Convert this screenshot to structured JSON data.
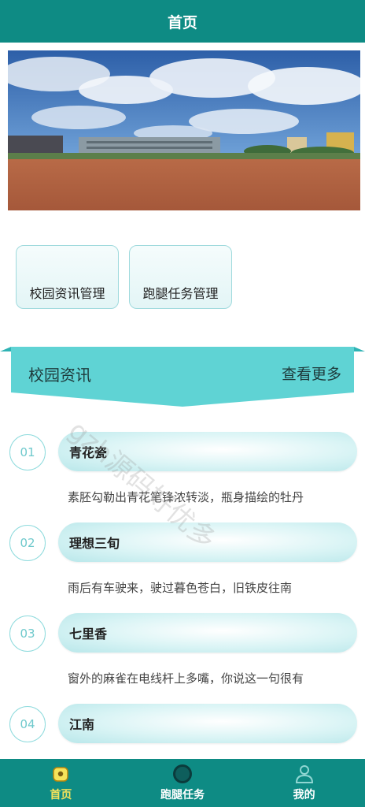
{
  "header": {
    "title": "首页"
  },
  "tiles": [
    {
      "label": "校园资讯管理"
    },
    {
      "label": "跑腿任务管理"
    }
  ],
  "section": {
    "title": "校园资讯",
    "more": "查看更多"
  },
  "watermark": "gzh源码好优多",
  "news": [
    {
      "num": "01",
      "title": "青花瓷",
      "desc": "素胚勾勒出青花笔锋浓转淡，瓶身描绘的牡丹"
    },
    {
      "num": "02",
      "title": "理想三旬",
      "desc": "雨后有车驶来，驶过暮色苍白，旧铁皮往南"
    },
    {
      "num": "03",
      "title": "七里香",
      "desc": "窗外的麻雀在电线杆上多嘴，你说这一句很有"
    },
    {
      "num": "04",
      "title": "江南",
      "desc": ""
    }
  ],
  "tabbar": {
    "items": [
      {
        "label": "首页",
        "icon": "home-icon",
        "active": true
      },
      {
        "label": "跑腿任务",
        "icon": "task-icon",
        "active": false
      },
      {
        "label": "我的",
        "icon": "user-icon",
        "active": false
      }
    ]
  },
  "colors": {
    "primary": "#0e8b84",
    "accent": "#5fd3d4",
    "active_tab": "#f6e35a"
  }
}
